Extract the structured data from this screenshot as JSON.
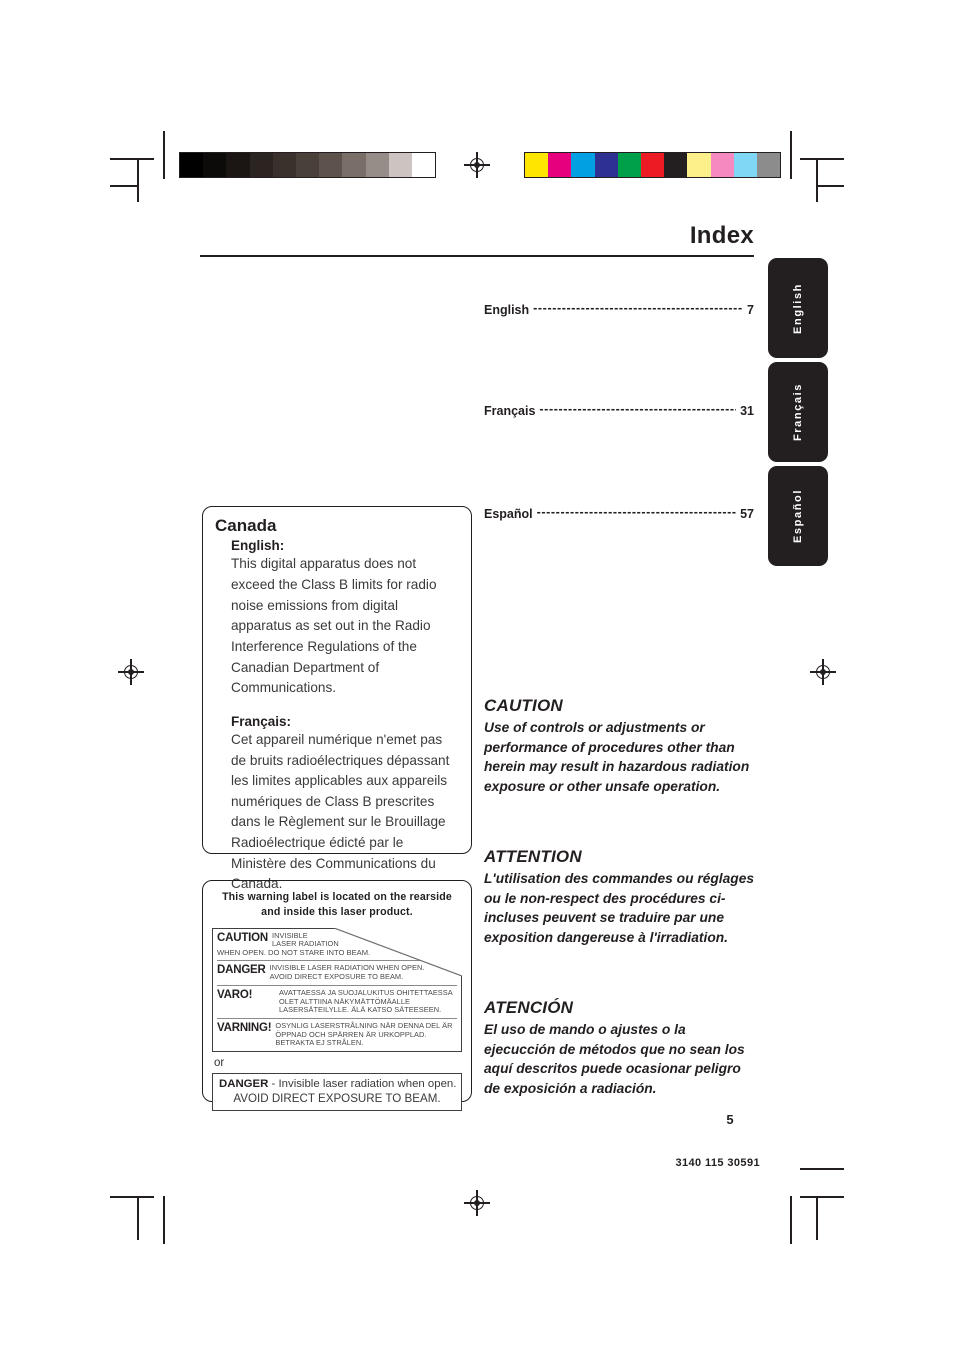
{
  "header": {
    "title": "Index"
  },
  "toc": {
    "entries": [
      {
        "language": "English",
        "dots": "--------------------------------------------",
        "page": "7"
      },
      {
        "language": "Français",
        "dots": "-------------------------------------------",
        "page": "31"
      },
      {
        "language": "Español",
        "dots": "--------------------------------------------",
        "page": "57"
      }
    ]
  },
  "language_tabs": [
    {
      "label": "English"
    },
    {
      "label": "Français"
    },
    {
      "label": "Español"
    }
  ],
  "canada_box": {
    "title": "Canada",
    "english_heading": "English:",
    "english_body": "This digital apparatus does not exceed the Class B limits for radio noise emissions from digital apparatus as set out in the Radio Interference Regulations of the Canadian Department of Communications.",
    "french_heading": "Français:",
    "french_body": "Cet appareil numérique n'emet pas de bruits radioélectriques dépassant les limites applicables aux appareils numériques de Class B prescrites dans le Règlement sur le Brouillage Radioélectrique édicté par le Ministère des Communications du Canada."
  },
  "warning_box": {
    "heading_line1": "This warning label is located on the rearside",
    "heading_line2": "and inside this laser product.",
    "laser_label": {
      "rows": [
        {
          "word": "CAUTION",
          "colon": ":",
          "text": "INVISIBLE\nLASER RADIATION",
          "full_width_text": "WHEN OPEN. DO NOT STARE INTO BEAM."
        },
        {
          "word": "DANGER",
          "colon": ":",
          "text": "INVISIBLE LASER RADIATION WHEN OPEN.\nAVOID DIRECT EXPOSURE TO BEAM.",
          "full_width_text": ""
        },
        {
          "word": "VARO!",
          "colon": "",
          "text": "AVATTAESSA JA SUOJALUKITUS OHITETTAESSA OLET ALTTIINA NÄKYMÄTTÖMÄALLE LASERSÄTEILYLLE. ÄLÄ KATSO SÄTEESEEN.",
          "full_width_text": ""
        },
        {
          "word": "VARNING!",
          "colon": "",
          "text": "OSYNLIG LASERSTRÅLNING NÄR DENNA DEL ÄR ÖPPNAD OCH SPÄRREN ÄR URKOPPLAD. BETRAKTA EJ STRÅLEN.",
          "full_width_text": ""
        }
      ]
    },
    "or_text": "or",
    "danger_box": {
      "word": "DANGER",
      "line1": " - Invisible laser radiation when open.",
      "line2": "AVOID DIRECT EXPOSURE TO BEAM."
    }
  },
  "cautions": [
    {
      "title": "CAUTION",
      "body": "Use of controls or adjustments or performance of procedures other than herein may result in hazardous radiation exposure or other unsafe operation."
    },
    {
      "title": "ATTENTION",
      "body": "L'utilisation des commandes ou réglages ou le non-respect des procédures ci-incluses peuvent se traduire par une exposition dangereuse à l'irradiation."
    },
    {
      "title": "ATENCIÓN",
      "body": "El uso de mando o ajustes o la ejecucción de métodos que no sean los aquí descritos puede ocasionar peligro de exposición a radiación."
    }
  ],
  "footer": {
    "page_number": "5",
    "document_code": "3140 115 30591"
  },
  "calibration": {
    "grayscale_swatches": [
      "#000000",
      "#0d0a0a",
      "#1b1614",
      "#2b2421",
      "#3a312c",
      "#4a403a",
      "#5e534c",
      "#796e68",
      "#978d88",
      "#cdc3c0",
      "#ffffff"
    ],
    "color_swatches": [
      "#ffe600",
      "#e6007e",
      "#00a0e3",
      "#2e3192",
      "#00a04a",
      "#ed1c24",
      "#231f20",
      "#fdf08a",
      "#f589c0",
      "#7fd6f5",
      "#8c8c8c"
    ]
  },
  "colors": {
    "ink": "#231f20",
    "body_text": "#3a3a3a",
    "tab_bg": "#231f20"
  }
}
